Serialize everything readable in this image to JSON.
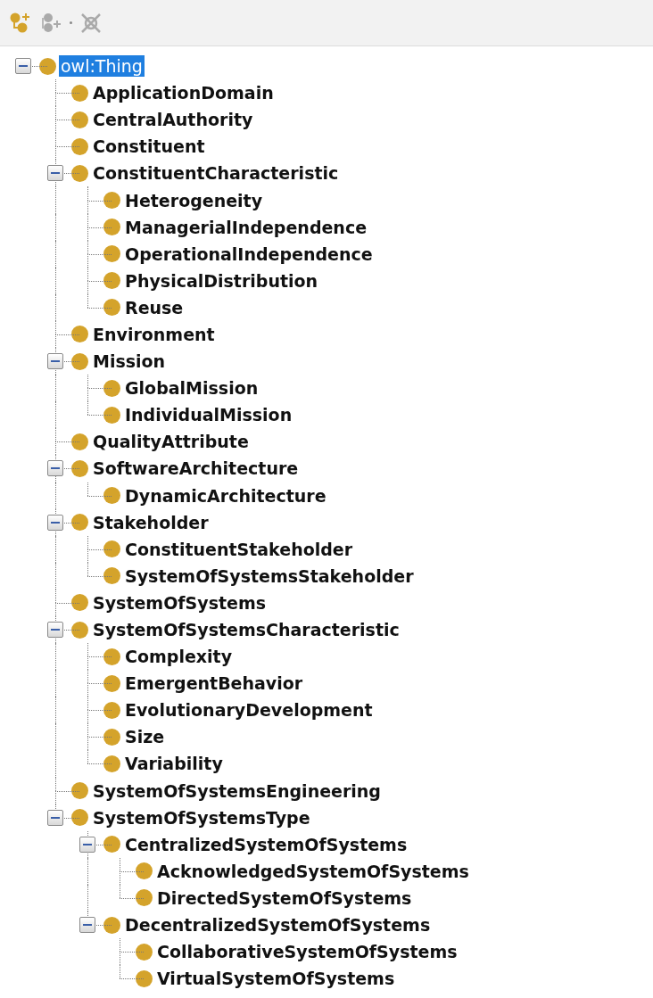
{
  "toolbar": [
    {
      "kind": "add-subclass",
      "disabled": false
    },
    {
      "kind": "add-sibling",
      "disabled": true
    },
    {
      "kind": "separator",
      "disabled": false
    },
    {
      "kind": "delete",
      "disabled": true
    }
  ],
  "tree": {
    "label": "owl:Thing",
    "kind": "thing",
    "selected": true,
    "expanded": true,
    "children": [
      {
        "label": "ApplicationDomain",
        "kind": "class",
        "selected": false
      },
      {
        "label": "CentralAuthority",
        "kind": "class",
        "selected": false
      },
      {
        "label": "Constituent",
        "kind": "class",
        "selected": false
      },
      {
        "label": "ConstituentCharacteristic",
        "kind": "class",
        "selected": false,
        "expanded": true,
        "children": [
          {
            "label": "Heterogeneity",
            "kind": "class",
            "selected": false
          },
          {
            "label": "ManagerialIndependence",
            "kind": "class",
            "selected": false
          },
          {
            "label": "OperationalIndependence",
            "kind": "class",
            "selected": false
          },
          {
            "label": "PhysicalDistribution",
            "kind": "class",
            "selected": false
          },
          {
            "label": "Reuse",
            "kind": "class",
            "selected": false
          }
        ]
      },
      {
        "label": "Environment",
        "kind": "class",
        "selected": false
      },
      {
        "label": "Mission",
        "kind": "class",
        "selected": false,
        "expanded": true,
        "children": [
          {
            "label": "GlobalMission",
            "kind": "class",
            "selected": false
          },
          {
            "label": "IndividualMission",
            "kind": "class",
            "selected": false
          }
        ]
      },
      {
        "label": "QualityAttribute",
        "kind": "class",
        "selected": false
      },
      {
        "label": "SoftwareArchitecture",
        "kind": "class",
        "selected": false,
        "expanded": true,
        "children": [
          {
            "label": "DynamicArchitecture",
            "kind": "class",
            "selected": false
          }
        ]
      },
      {
        "label": "Stakeholder",
        "kind": "class",
        "selected": false,
        "expanded": true,
        "children": [
          {
            "label": "ConstituentStakeholder",
            "kind": "class",
            "selected": false
          },
          {
            "label": "SystemOfSystemsStakeholder",
            "kind": "class",
            "selected": false
          }
        ]
      },
      {
        "label": "SystemOfSystems",
        "kind": "class",
        "selected": false
      },
      {
        "label": "SystemOfSystemsCharacteristic",
        "kind": "class",
        "selected": false,
        "expanded": true,
        "children": [
          {
            "label": "Complexity",
            "kind": "class",
            "selected": false
          },
          {
            "label": "EmergentBehavior",
            "kind": "class",
            "selected": false
          },
          {
            "label": "EvolutionaryDevelopment",
            "kind": "class",
            "selected": false
          },
          {
            "label": "Size",
            "kind": "class",
            "selected": false
          },
          {
            "label": "Variability",
            "kind": "class",
            "selected": false
          }
        ]
      },
      {
        "label": "SystemOfSystemsEngineering",
        "kind": "class",
        "selected": false
      },
      {
        "label": "SystemOfSystemsType",
        "kind": "class",
        "selected": false,
        "expanded": true,
        "children": [
          {
            "label": "CentralizedSystemOfSystems",
            "kind": "class",
            "selected": false,
            "expanded": true,
            "children": [
              {
                "label": "AcknowledgedSystemOfSystems",
                "kind": "class",
                "selected": false
              },
              {
                "label": "DirectedSystemOfSystems",
                "kind": "class",
                "selected": false
              }
            ]
          },
          {
            "label": "DecentralizedSystemOfSystems",
            "kind": "class",
            "selected": false,
            "expanded": true,
            "children": [
              {
                "label": "CollaborativeSystemOfSystems",
                "kind": "class",
                "selected": false
              },
              {
                "label": "VirtualSystemOfSystems",
                "kind": "class",
                "selected": false
              }
            ]
          }
        ]
      }
    ]
  }
}
